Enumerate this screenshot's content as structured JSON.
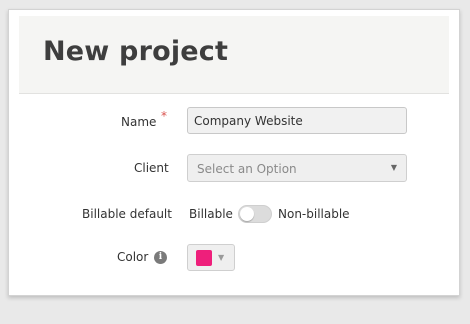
{
  "page": {
    "title": "New project"
  },
  "form": {
    "name_label": "Name",
    "name_required_marker": "*",
    "name_value": "Company Website",
    "client_label": "Client",
    "client_placeholder": "Select an Option",
    "billable_label": "Billable default",
    "billable_option_on": "Billable",
    "billable_option_off": "Non-billable",
    "billable_state": "billable",
    "color_label": "Color",
    "color_value": "#ee1f7b"
  },
  "icons": {
    "info": "info-icon",
    "select_caret": "caret-down-icon",
    "picker_caret": "caret-down-icon"
  },
  "colors": {
    "title": "#3e3e3e",
    "required": "#d9534f",
    "swatch": "#ee1f7b"
  }
}
